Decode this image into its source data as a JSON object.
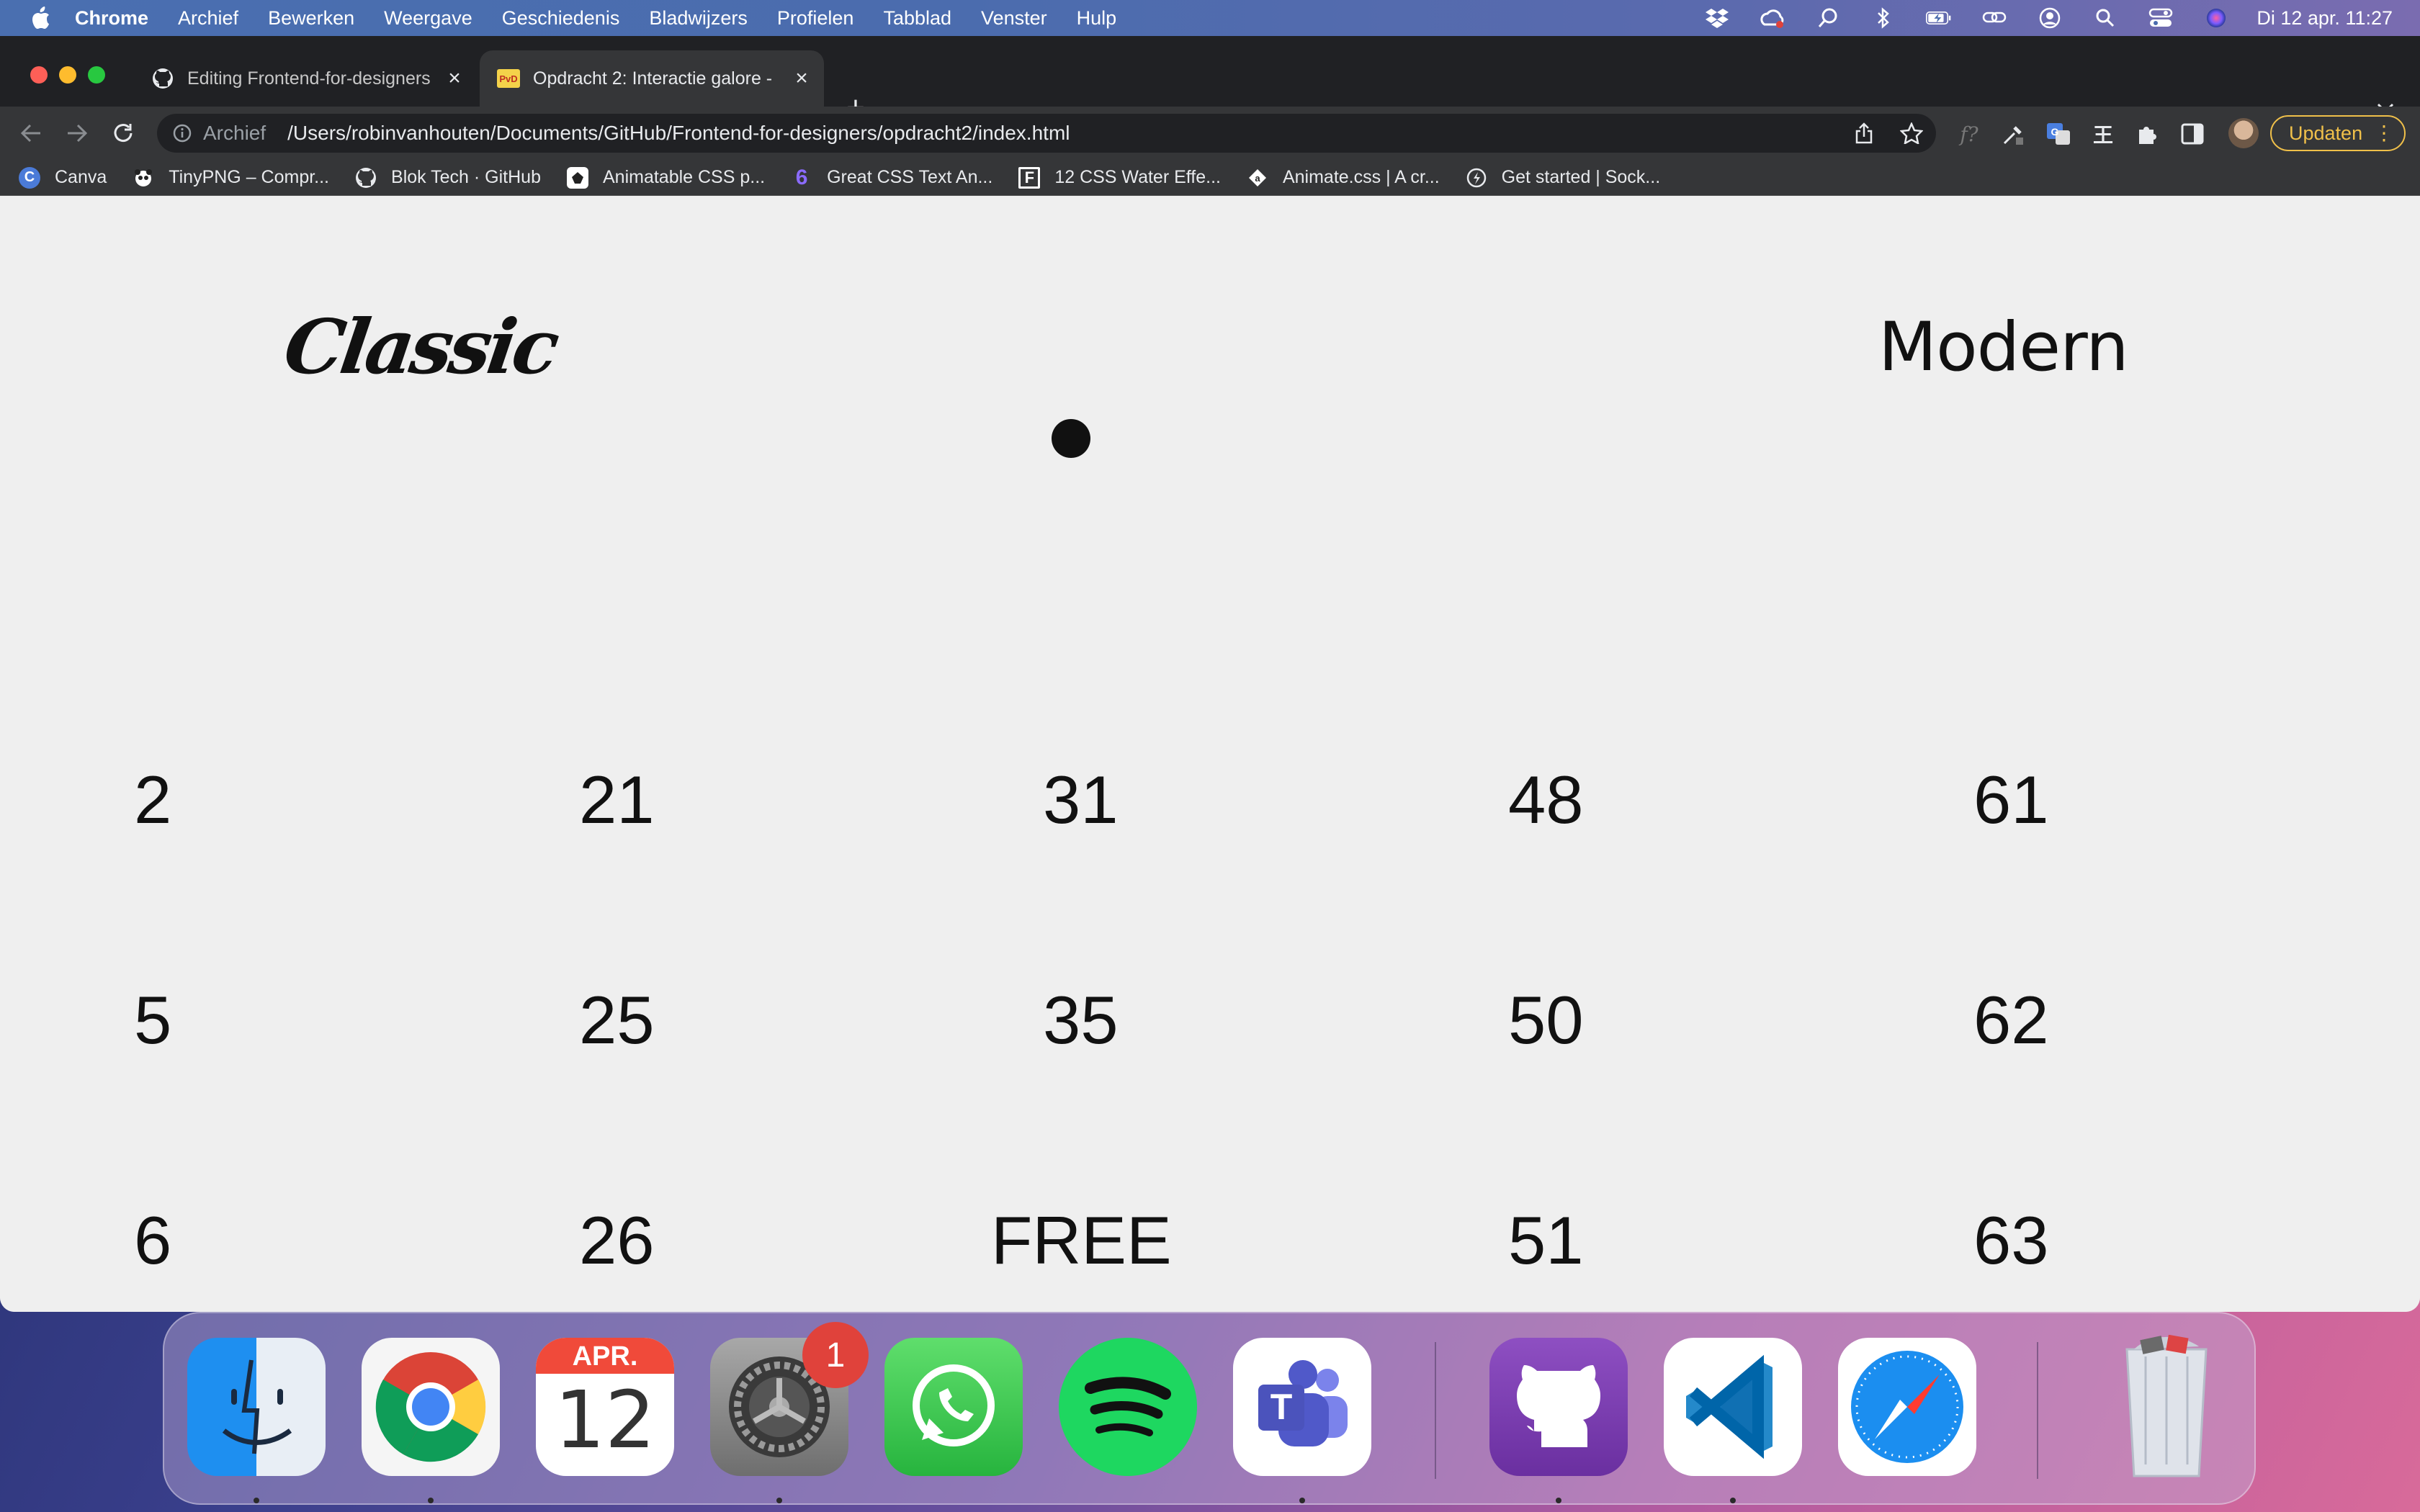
{
  "menubar": {
    "app_name": "Chrome",
    "items": [
      "Archief",
      "Bewerken",
      "Weergave",
      "Geschiedenis",
      "Bladwijzers",
      "Profielen",
      "Tabblad",
      "Venster",
      "Hulp"
    ],
    "clock": "Di 12 apr. 11:27",
    "status_icons": [
      "dropbox-icon",
      "creative-cloud-icon",
      "spotlight-alt-icon",
      "bluetooth-icon",
      "battery-icon",
      "screen-mirroring-icon",
      "user-icon",
      "search-icon",
      "control-center-icon",
      "siri-icon"
    ]
  },
  "tabs": [
    {
      "title": "Editing Frontend-for-designers",
      "icon": "github-icon",
      "active": false
    },
    {
      "title": "Opdracht 2: Interactie galore -",
      "icon": "pvd-icon",
      "active": true
    }
  ],
  "toolbar": {
    "scheme_label": "Archief",
    "url": "/Users/robinvanhouten/Documents/GitHub/Frontend-for-designers/opdracht2/index.html",
    "update_label": "Updaten"
  },
  "bookmarks": [
    {
      "label": "Canva",
      "icon": "canva-icon",
      "color": "#4b7bd8"
    },
    {
      "label": "TinyPNG – Compr...",
      "icon": "panda-icon",
      "color": "#ffffff"
    },
    {
      "label": "Blok Tech · GitHub",
      "icon": "github-icon",
      "color": "#ffffff"
    },
    {
      "label": "Animatable CSS p...",
      "icon": "animatable-icon",
      "color": "#ffffff"
    },
    {
      "label": "Great CSS Text An...",
      "icon": "six-icon",
      "color": "#6b4bd8"
    },
    {
      "label": "12 CSS Water Effe...",
      "icon": "f-icon",
      "color": "#ffffff"
    },
    {
      "label": "Animate.css | A cr...",
      "icon": "animate-icon",
      "color": "#ffffff"
    },
    {
      "label": "Get started | Sock...",
      "icon": "socket-icon",
      "color": "#ffffff"
    }
  ],
  "page": {
    "classic_label": "Classic",
    "modern_label": "Modern",
    "bingo": [
      [
        "2",
        "21",
        "31",
        "48",
        "61"
      ],
      [
        "5",
        "25",
        "35",
        "50",
        "62"
      ],
      [
        "6",
        "26",
        "FREE",
        "51",
        "63"
      ]
    ]
  },
  "dock": {
    "apps": [
      "finder",
      "chrome",
      "calendar",
      "system-settings",
      "whatsapp",
      "spotify",
      "teams",
      "github-desktop",
      "vscode",
      "safari",
      "trash"
    ],
    "calendar_month": "APR.",
    "calendar_day": "12",
    "settings_badge": "1"
  }
}
